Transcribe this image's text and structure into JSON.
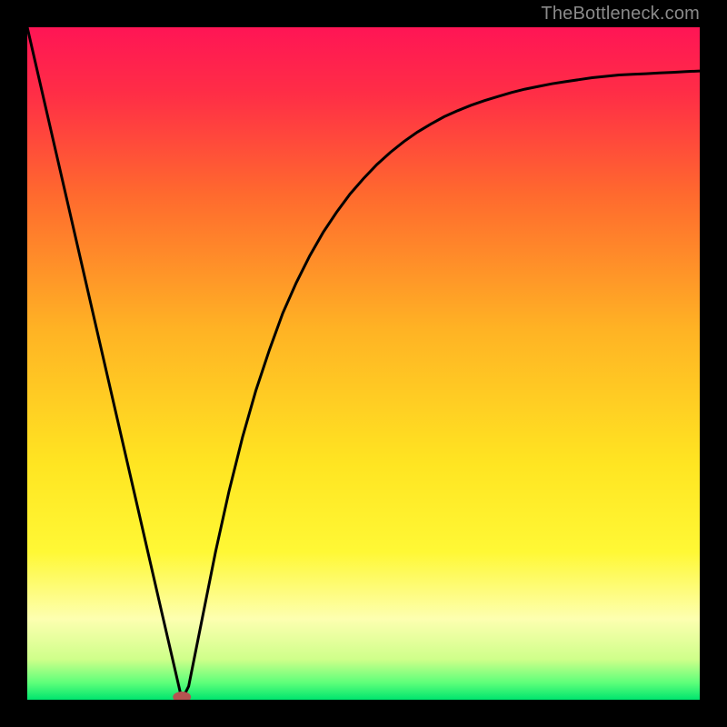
{
  "watermark": "TheBottleneck.com",
  "chart_data": {
    "type": "line",
    "title": "",
    "xlabel": "",
    "ylabel": "",
    "xlim": [
      0,
      100
    ],
    "ylim": [
      0,
      100
    ],
    "series": [
      {
        "name": "curve",
        "x": [
          0,
          2,
          4,
          6,
          8,
          10,
          12,
          14,
          16,
          18,
          20,
          22,
          23,
          24,
          26,
          28,
          30,
          32,
          34,
          36,
          38,
          40,
          42,
          44,
          46,
          48,
          50,
          52,
          54,
          56,
          58,
          60,
          62,
          64,
          66,
          68,
          70,
          72,
          74,
          76,
          78,
          80,
          82,
          84,
          86,
          88,
          90,
          92,
          94,
          96,
          98,
          100
        ],
        "y": [
          100,
          91.3,
          82.6,
          73.9,
          65.2,
          56.5,
          47.8,
          39.1,
          30.4,
          21.7,
          13.0,
          4.35,
          0,
          2.0,
          12.0,
          22.0,
          31.0,
          39.0,
          46.0,
          52.0,
          57.5,
          62.0,
          66.0,
          69.5,
          72.5,
          75.2,
          77.5,
          79.6,
          81.4,
          83.0,
          84.4,
          85.6,
          86.7,
          87.6,
          88.4,
          89.1,
          89.7,
          90.3,
          90.8,
          91.2,
          91.6,
          91.9,
          92.2,
          92.5,
          92.7,
          92.9,
          93.0,
          93.1,
          93.2,
          93.3,
          93.4,
          93.5
        ]
      }
    ],
    "marker": {
      "x": 23,
      "y": 0,
      "color": "#b55451"
    },
    "background_gradient": {
      "stops": [
        {
          "t": 0.0,
          "color": "#ff1555"
        },
        {
          "t": 0.1,
          "color": "#ff2e46"
        },
        {
          "t": 0.25,
          "color": "#ff6a2e"
        },
        {
          "t": 0.45,
          "color": "#ffb324"
        },
        {
          "t": 0.65,
          "color": "#ffe522"
        },
        {
          "t": 0.78,
          "color": "#fff835"
        },
        {
          "t": 0.88,
          "color": "#fdffb0"
        },
        {
          "t": 0.94,
          "color": "#cfff8a"
        },
        {
          "t": 0.975,
          "color": "#5dff7a"
        },
        {
          "t": 1.0,
          "color": "#00e56e"
        }
      ]
    }
  }
}
